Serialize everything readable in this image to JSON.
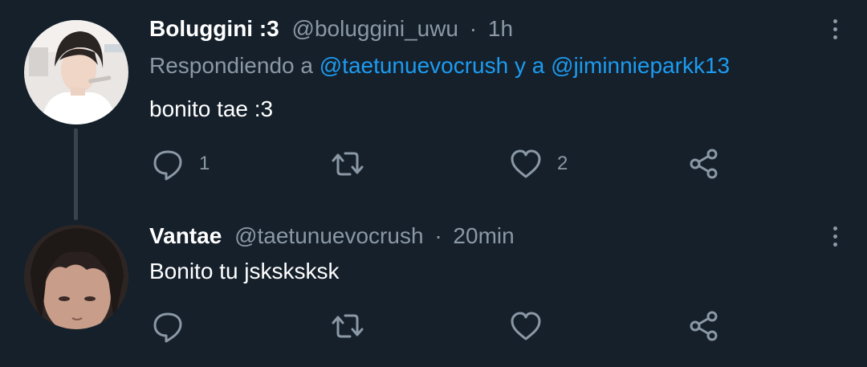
{
  "tweets": [
    {
      "display_name": "Boluggini :3",
      "handle": "@boluggini_uwu",
      "separator": "·",
      "time": "1h",
      "reply_prefix": "Respondiendo a",
      "reply_to_1": "@taetunuevocrush",
      "reply_joiner": "y a",
      "reply_to_2": "@jiminnieparkk13",
      "text": "bonito tae :3",
      "reply_count": "1",
      "retweet_count": "",
      "like_count": "2"
    },
    {
      "display_name": "Vantae",
      "handle": "@taetunuevocrush",
      "separator": "·",
      "time": "20min",
      "text": "Bonito tu jsksksksk",
      "reply_count": "",
      "retweet_count": "",
      "like_count": ""
    }
  ],
  "icons": {
    "reply": "comment-icon",
    "retweet": "retweet-icon",
    "like": "heart-icon",
    "share": "share-icon",
    "more": "more-vertical-icon"
  },
  "colors": {
    "background": "#15202b",
    "text": "#ffffff",
    "muted": "#8b98a5",
    "mention": "#1d9bf0",
    "thread_line": "#38444d"
  }
}
